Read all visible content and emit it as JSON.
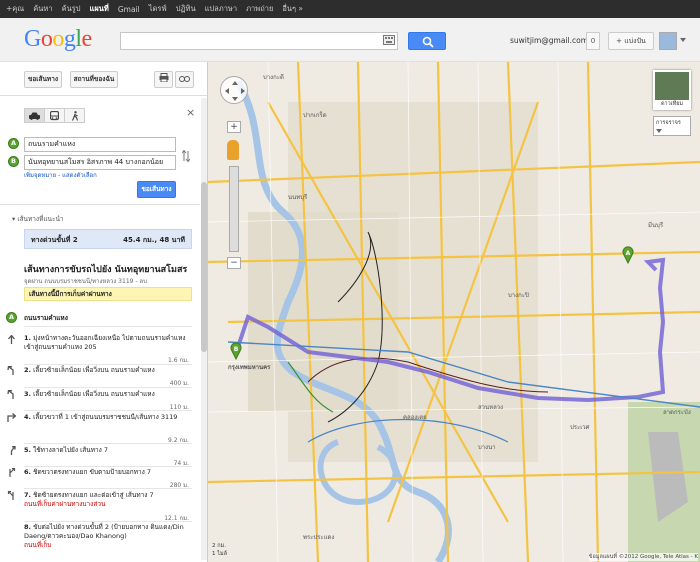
{
  "topbar": {
    "items": [
      "+คุณ",
      "ค้นหา",
      "ค้นรูป",
      "แผนที่",
      "Gmail",
      "ไดรฟ์",
      "ปฏิทิน",
      "แปลภาษา",
      "ภาพถ่าย",
      "อื่นๆ »"
    ],
    "active_index": 3
  },
  "header": {
    "logo": "Google",
    "search_value": "",
    "user_email": "suwitjim@gmail.com",
    "notifications": "0",
    "share_label": "+ แบ่งปัน"
  },
  "panel": {
    "tabs": [
      "ขอเส้นทาง",
      "สถานที่ของฉัน"
    ],
    "mode_icons": [
      "car-icon",
      "transit-icon",
      "walk-icon"
    ],
    "from_value": "ถนนรามคำแหง",
    "to_value": "นันทอุทยานสโมสร อิสรภาพ 44 บางกอกน้อย",
    "small_links": "เพิ่มจุดหมาย - แสดงตัวเลือก",
    "go_label": "ขอเส้นทาง",
    "routes_header": "เส้นทางที่แนะนำ",
    "route": {
      "name": "ทางด่วนขั้นที่ 2",
      "distance": "45.4 กม., 48 นาที"
    },
    "dest_title": "เส้นทางการขับรถไปยัง นันทอุทยานสโมสร",
    "dest_sub": "จุดผ่าน ถนนบรมราชชนนี/ทางหลวง 3119 - ลบ",
    "toll_notice": "เส้นทางนี้มีการเก็บค่าผ่านทาง",
    "start_label": "ถนนรามคำแหง",
    "steps": [
      {
        "num": "1.",
        "text": "มุ่งหน้าทางตะวันออกเฉียงเหนือ ไปตามถนนรามคำแหง เข้าสู่ถนนรามคำแหง 205",
        "dist": "1.6 กม."
      },
      {
        "num": "2.",
        "text": "เลี้ยวซ้ายเล็กน้อย เพื่อวิ่งบน ถนนรามคำแหง",
        "dist": "400 ม."
      },
      {
        "num": "3.",
        "text": "เลี้ยวซ้ายเล็กน้อย เพื่อวิ่งบน ถนนรามคำแหง",
        "dist": "110 ม."
      },
      {
        "num": "4.",
        "text": "เลี้ยวขวาที่ 1 เข้าสู่ถนนบรมราชชนนี/เส้นทาง 3119",
        "dist": "9.2 กม."
      },
      {
        "num": "5.",
        "text": "ใช้ทางลาดไปยัง เส้นทาง 7",
        "dist": "74 ม."
      },
      {
        "num": "6.",
        "text": "ชิดขวาตรงทางแยก ขับตามป้ายบอกทาง 7",
        "dist": "280 ม."
      },
      {
        "num": "7.",
        "text": "ชิดซ้ายตรงทางแยก และต่อเข้าสู่ เส้นทาง 7",
        "note": "ถนนที่เก็บค่าผ่านทางบางส่วน",
        "dist": "12.1 กม."
      },
      {
        "num": "8.",
        "text": "ขับต่อไปยัง ทางด่วนขั้นที่ 2 (ป้ายบอกทาง ดินแดง/Din Daeng/ดาวคะนอง/Dao Khanong)",
        "note": "ถนนที่เก็บ"
      }
    ]
  },
  "map": {
    "labels": [
      "บางกะดี",
      "นนทบุรี",
      "ปากเกร็ด",
      "มีนบุรี",
      "กรุงเทพมหานคร",
      "บางกะปิ",
      "ลาดกระบัง",
      "พระประแดง",
      "คลองเตย",
      "สวนหลวง",
      "ประเวศ",
      "บางนา"
    ],
    "satellite_label": "ดาวเทียม",
    "traffic_label": "การจราจร",
    "scale": [
      "2 กม.",
      "1 ไมล์"
    ],
    "copyright": "ข้อมูลแผนที่ ©2012 Google, Tele Atlas - K"
  },
  "colors": {
    "route": "#6f5fd6",
    "google_blue": "#4a8af4",
    "marker_green": "#5aa42d"
  }
}
